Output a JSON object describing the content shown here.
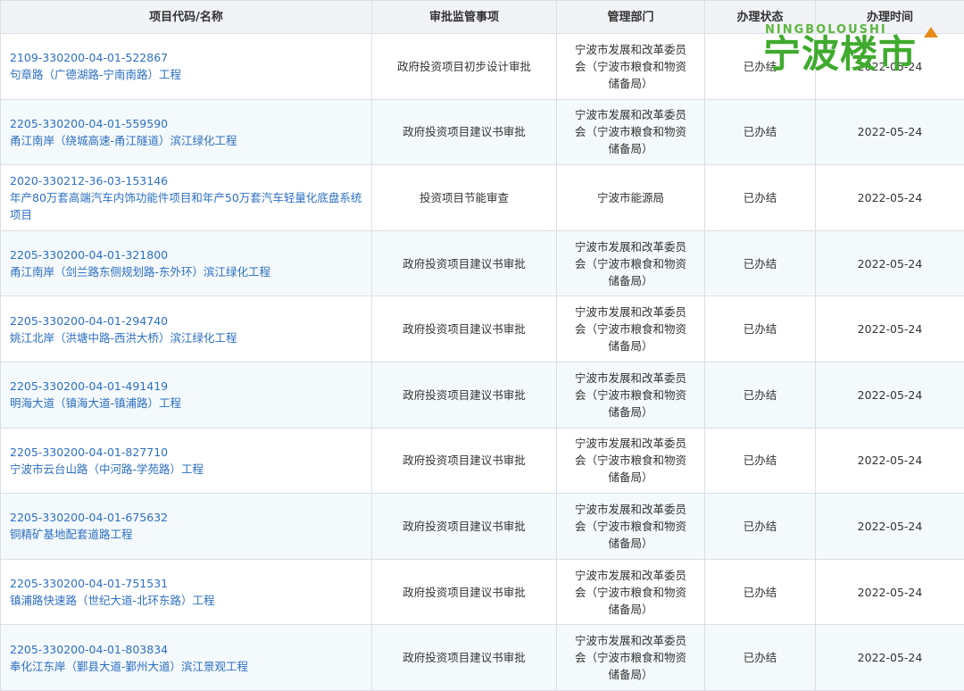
{
  "table": {
    "headers": [
      "项目代码/名称",
      "审批监管事项",
      "管理部门",
      "办理状态",
      "办理时间"
    ],
    "rows": [
      {
        "code": "2109-330200-04-01-522867",
        "name": "句章路（广德湖路-宁南南路）工程",
        "item": "政府投资项目初步设计审批",
        "dept": "宁波市发展和改革委员会（宁波市粮食和物资储备局）",
        "status": "已办结",
        "time": "2022-05-24"
      },
      {
        "code": "2205-330200-04-01-559590",
        "name": "甬江南岸（绕城高速-甬江隧道）滨江绿化工程",
        "item": "政府投资项目建议书审批",
        "dept": "宁波市发展和改革委员会（宁波市粮食和物资储备局）",
        "status": "已办结",
        "time": "2022-05-24"
      },
      {
        "code": "2020-330212-36-03-153146",
        "name": "年产80万套高端汽车内饰功能件项目和年产50万套汽车轻量化底盘系统项目",
        "item": "投资项目节能审查",
        "dept": "宁波市能源局",
        "status": "已办结",
        "time": "2022-05-24"
      },
      {
        "code": "2205-330200-04-01-321800",
        "name": "甬江南岸（剑兰路东侧规划路-东外环）滨江绿化工程",
        "item": "政府投资项目建议书审批",
        "dept": "宁波市发展和改革委员会（宁波市粮食和物资储备局）",
        "status": "已办结",
        "time": "2022-05-24"
      },
      {
        "code": "2205-330200-04-01-294740",
        "name": "姚江北岸（洪塘中路-西洪大桥）滨江绿化工程",
        "item": "政府投资项目建议书审批",
        "dept": "宁波市发展和改革委员会（宁波市粮食和物资储备局）",
        "status": "已办结",
        "time": "2022-05-24"
      },
      {
        "code": "2205-330200-04-01-491419",
        "name": "明海大道（镇海大道-镇浦路）工程",
        "item": "政府投资项目建议书审批",
        "dept": "宁波市发展和改革委员会（宁波市粮食和物资储备局）",
        "status": "已办结",
        "time": "2022-05-24"
      },
      {
        "code": "2205-330200-04-01-827710",
        "name": "宁波市云台山路（中河路-学苑路）工程",
        "item": "政府投资项目建议书审批",
        "dept": "宁波市发展和改革委员会（宁波市粮食和物资储备局）",
        "status": "已办结",
        "time": "2022-05-24"
      },
      {
        "code": "2205-330200-04-01-675632",
        "name": "铜精矿基地配套道路工程",
        "item": "政府投资项目建议书审批",
        "dept": "宁波市发展和改革委员会（宁波市粮食和物资储备局）",
        "status": "已办结",
        "time": "2022-05-24"
      },
      {
        "code": "2205-330200-04-01-751531",
        "name": "镇浦路快速路（世纪大道-北环东路）工程",
        "item": "政府投资项目建议书审批",
        "dept": "宁波市发展和改革委员会（宁波市粮食和物资储备局）",
        "status": "已办结",
        "time": "2022-05-24"
      },
      {
        "code": "2205-330200-04-01-803834",
        "name": "奉化江东岸（鄞县大道-鄞州大道）滨江景观工程",
        "item": "政府投资项目建议书审批",
        "dept": "宁波市发展和改革委员会（宁波市粮食和物资储备局）",
        "status": "已办结",
        "time": "2022-05-24"
      }
    ]
  },
  "watermark": {
    "top": "NINGBOLOUSHI",
    "main": "宁波楼市"
  },
  "colors": {
    "link": "#2d6fc2",
    "header_bg": "#f1f3f6",
    "stripe_bg": "#f4f9fb",
    "watermark_green": "#3faa2e",
    "watermark_orange": "#e88a1a"
  }
}
